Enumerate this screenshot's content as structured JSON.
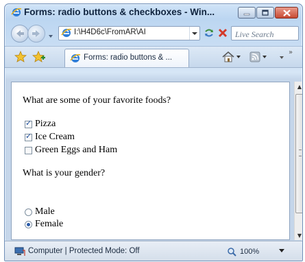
{
  "window": {
    "title": "Forms: radio buttons & checkboxes - Win...",
    "controls": [
      "minimize",
      "maximize",
      "close"
    ]
  },
  "navbar": {
    "address": "I:\\H4D6c\\FromAR\\AI",
    "search_placeholder": "Live Search"
  },
  "tabbar": {
    "tab_label": "Forms: radio buttons & ...",
    "more_label": "»"
  },
  "content": {
    "question_foods": "What are some of your favorite foods?",
    "foods": [
      {
        "label": "Pizza",
        "checked": true
      },
      {
        "label": "Ice Cream",
        "checked": true
      },
      {
        "label": "Green Eggs and Ham",
        "checked": false
      }
    ],
    "question_gender": "What is your gender?",
    "genders": [
      {
        "label": "Male",
        "selected": false
      },
      {
        "label": "Female",
        "selected": true
      }
    ]
  },
  "statusbar": {
    "text": "Computer | Protected Mode: Off",
    "zoom": "100%"
  },
  "colors": {
    "chrome_blue": "#bcd6f1",
    "close_red": "#c74a33",
    "check_blue": "#1a4b9b"
  }
}
